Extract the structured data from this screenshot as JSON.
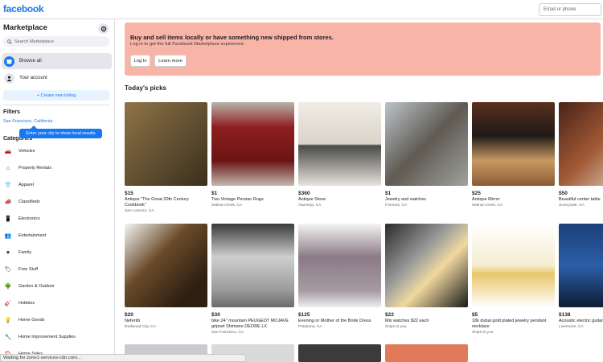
{
  "topbar": {
    "logo": "facebook",
    "email_placeholder": "Email or phone"
  },
  "sidebar": {
    "title": "Marketplace",
    "search_placeholder": "Search Marketplace",
    "nav": [
      {
        "label": "Browse all",
        "icon": "storefront-icon"
      },
      {
        "label": "Your account",
        "icon": "person-icon"
      }
    ],
    "create_label": "+ Create new listing",
    "filters_title": "Filters",
    "location": "San Francisco, California",
    "tooltip": "Enter your city to show local results",
    "categories_title": "Categories",
    "categories": [
      {
        "label": "Vehicles",
        "icon": "car-icon"
      },
      {
        "label": "Property Rentals",
        "icon": "house-icon"
      },
      {
        "label": "Apparel",
        "icon": "shirt-icon"
      },
      {
        "label": "Classifieds",
        "icon": "megaphone-icon"
      },
      {
        "label": "Electronics",
        "icon": "phone-icon"
      },
      {
        "label": "Entertainment",
        "icon": "people-icon"
      },
      {
        "label": "Family",
        "icon": "heart-icon"
      },
      {
        "label": "Free Stuff",
        "icon": "tag-icon"
      },
      {
        "label": "Garden & Outdoor",
        "icon": "tree-icon"
      },
      {
        "label": "Hobbies",
        "icon": "guitar-icon"
      },
      {
        "label": "Home Goods",
        "icon": "lamp-icon"
      },
      {
        "label": "Home Improvement Supplies",
        "icon": "wrench-icon"
      },
      {
        "label": "Home Sales",
        "icon": "house-sale-icon"
      }
    ]
  },
  "banner": {
    "title": "Buy and sell items locally or have something new shipped from stores.",
    "subtitle": "Log in to get the full Facebook Marketplace experience.",
    "login": "Log In",
    "learn_more": "Learn more",
    "color": "#f8b4a6"
  },
  "picks_title": "Today's picks",
  "listings": [
    {
      "price": "$15",
      "title": "Antique \"The Great 20th Century Cookbook\"",
      "location": "San Lorenzo, CA"
    },
    {
      "price": "$1",
      "title": "Two Vintage Persian Rugs",
      "location": "Walnut Creek, CA"
    },
    {
      "price": "$360",
      "title": "Antique Stove",
      "location": "Alameda, CA"
    },
    {
      "price": "$1",
      "title": "Jewelry and watches",
      "location": "Fremont, CA"
    },
    {
      "price": "$25",
      "title": "Antique Mirror",
      "location": "Walnut Creek, CA"
    },
    {
      "price": "$50",
      "title": "Beautiful center table",
      "location": "Sunnyvale, CA"
    },
    {
      "price": "$20",
      "title": "Nefertiti",
      "location": "Redwood City, CA"
    },
    {
      "price": "$30",
      "title": "bike 24\" mountain PEUGEOT MOJAVE gripset Shimano DEORE LX",
      "location": "San Francisco, CA"
    },
    {
      "price": "$125",
      "title": "Evening or Mother of the Bride Dress",
      "location": "Petaluma, CA"
    },
    {
      "price": "$22",
      "title": "Mix watches $22 each",
      "location": "Ships to you"
    },
    {
      "price": "$5",
      "title": "18k dubai gold plated jewelry pendant necklace",
      "location": "Ships to you"
    },
    {
      "price": "$138",
      "title": "Acoustic electric guitar",
      "location": "Livermore, CA"
    }
  ],
  "status_text": "Waiting for zone1-services-cdn.com..."
}
